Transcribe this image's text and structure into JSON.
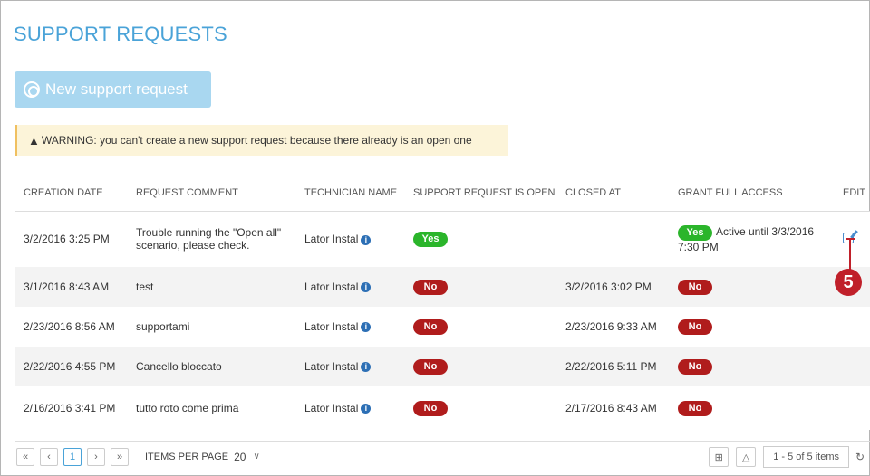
{
  "page": {
    "title": "SUPPORT REQUESTS",
    "new_button_label": "New support request",
    "warning_text": "WARNING: you can't create a new support request because there already is an open one"
  },
  "table": {
    "columns": [
      "CREATION DATE",
      "REQUEST COMMENT",
      "TECHNICIAN NAME",
      "SUPPORT REQUEST IS OPEN",
      "CLOSED AT",
      "GRANT FULL ACCESS",
      "EDIT"
    ],
    "rows": [
      {
        "created": "3/2/2016 3:25 PM",
        "comment": "Trouble running the \"Open all\" scenario, please check.",
        "technician": "Lator Instal",
        "open": "Yes",
        "closed_at": "",
        "full_access": "Yes",
        "access_note": "Active until 3/3/2016 7:30 PM"
      },
      {
        "created": "3/1/2016 8:43 AM",
        "comment": "test",
        "technician": "Lator Instal",
        "open": "No",
        "closed_at": "3/2/2016 3:02 PM",
        "full_access": "No",
        "access_note": ""
      },
      {
        "created": "2/23/2016 8:56 AM",
        "comment": "supportami",
        "technician": "Lator Instal",
        "open": "No",
        "closed_at": "2/23/2016 9:33 AM",
        "full_access": "No",
        "access_note": ""
      },
      {
        "created": "2/22/2016 4:55 PM",
        "comment": "Cancello bloccato",
        "technician": "Lator Instal",
        "open": "No",
        "closed_at": "2/22/2016 5:11 PM",
        "full_access": "No",
        "access_note": ""
      },
      {
        "created": "2/16/2016 3:41 PM",
        "comment": "tutto roto come prima",
        "technician": "Lator Instal",
        "open": "No",
        "closed_at": "2/17/2016 8:43 AM",
        "full_access": "No",
        "access_note": ""
      }
    ]
  },
  "callout": {
    "number": "5"
  },
  "pager": {
    "first": "«",
    "prev": "‹",
    "current_page": "1",
    "next": "›",
    "last": "»",
    "items_per_page_label": "ITEMS PER PAGE",
    "items_per_page_value": "20",
    "items_count": "1 - 5 of 5 items",
    "icons": [
      "excel-export-icon",
      "pdf-export-icon",
      "refresh-icon"
    ]
  },
  "colors": {
    "accent": "#4aa3d8",
    "yes": "#2bb52b",
    "no": "#b01c1c",
    "callout": "#c0202a",
    "warning_bg": "#fcf4d9"
  }
}
